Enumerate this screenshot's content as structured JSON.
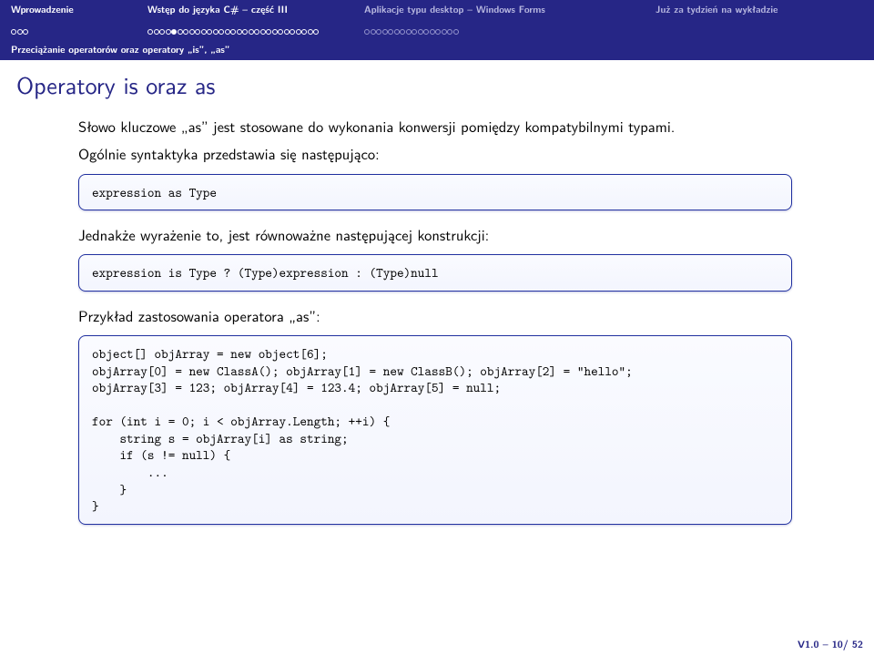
{
  "nav": {
    "n1": "Wprowadzenie",
    "n2": "Wstęp do języka C# – część III",
    "n3": "Aplikacje typu desktop – Windows Forms",
    "n4": "Już za tydzień na wykładzie"
  },
  "subhead": "Przeciążanie operatorów oraz operatory „is”, „as”",
  "title": "Operatory is oraz as",
  "content": {
    "p1": "Słowo kluczowe „as” jest stosowane do wykonania konwersji pomiędzy kompatybilnymi typami.",
    "p2": "Ogólnie syntaktyka przedstawia się następująco:",
    "code1": "expression as Type",
    "p3": "Jednakże wyrażenie to, jest równoważne następującej konstrukcji:",
    "code2": "expression is Type ? (Type)expression : (Type)null",
    "p4": "Przykład zastosowania operatora „as”:",
    "code3": "object[] objArray = new object[6];\nobjArray[0] = new ClassA(); objArray[1] = new ClassB(); objArray[2] = \"hello\";\nobjArray[3] = 123; objArray[4] = 123.4; objArray[5] = null;\n\nfor (int i = 0; i < objArray.Length; ++i) {\n    string s = objArray[i] as string;\n    if (s != null) {\n        ...\n    }\n}"
  },
  "footer": "V1.0 – 10/ 52"
}
